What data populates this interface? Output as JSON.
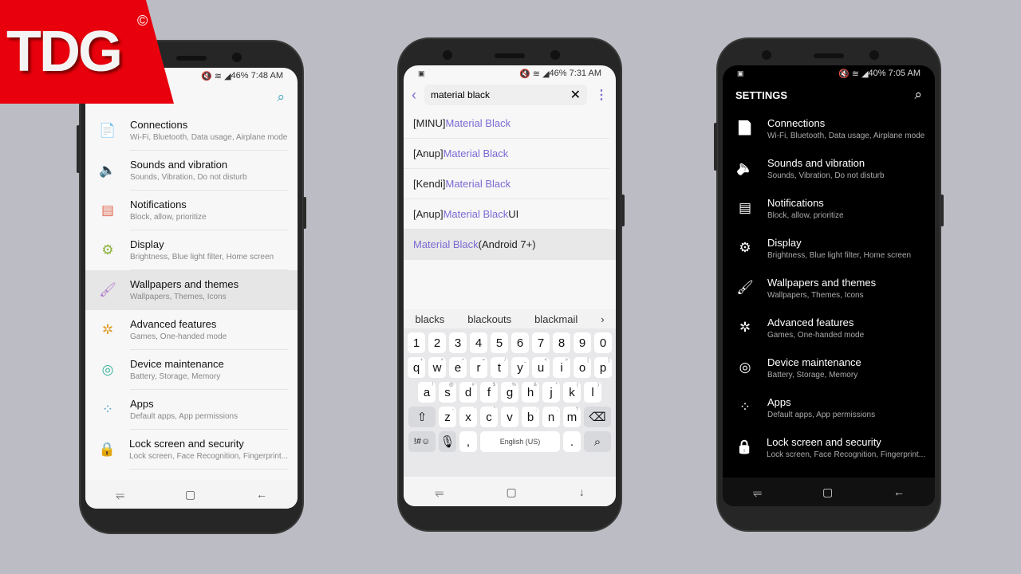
{
  "logo": {
    "text": "TDG",
    "mark": "©"
  },
  "colors": {
    "accent": "#7b6ad3",
    "logo_red": "#e8000c"
  },
  "left_phone": {
    "status": {
      "battery": "46%",
      "time": "7:48 AM"
    },
    "search_icon": "search-icon",
    "items": [
      {
        "title": "Connections",
        "sub": "Wi-Fi, Bluetooth, Data usage, Airplane mode",
        "icon": "📄",
        "color": "#4a9fc9"
      },
      {
        "title": "Sounds and vibration",
        "sub": "Sounds, Vibration, Do not disturb",
        "icon": "🔈",
        "color": "#4a7fc9"
      },
      {
        "title": "Notifications",
        "sub": "Block, allow, prioritize",
        "icon": "▤",
        "color": "#e06a50"
      },
      {
        "title": "Display",
        "sub": "Brightness, Blue light filter, Home screen",
        "icon": "⚙",
        "color": "#8ab13a"
      },
      {
        "title": "Wallpapers and themes",
        "sub": "Wallpapers, Themes, Icons",
        "icon": "🖌",
        "color": "#b07ac9",
        "selected": true
      },
      {
        "title": "Advanced features",
        "sub": "Games, One-handed mode",
        "icon": "✲",
        "color": "#e0a030"
      },
      {
        "title": "Device maintenance",
        "sub": "Battery, Storage, Memory",
        "icon": "◎",
        "color": "#3ab19a"
      },
      {
        "title": "Apps",
        "sub": "Default apps, App permissions",
        "icon": "⁘",
        "color": "#4a9fc9"
      },
      {
        "title": "Lock screen and security",
        "sub": "Lock screen, Face Recognition, Fingerprint...",
        "icon": "🔒",
        "color": "#7a6ac9"
      }
    ]
  },
  "middle_phone": {
    "status": {
      "battery": "46%",
      "time": "7:31 AM"
    },
    "query": "material black",
    "results": [
      {
        "pre": "[MINU]",
        "hl": "Material Black",
        "post": ""
      },
      {
        "pre": "[Anup] ",
        "hl": "Material Black",
        "post": ""
      },
      {
        "pre": "[Kendi] ",
        "hl": "Material Black",
        "post": ""
      },
      {
        "pre": "[Anup] ",
        "hl": "Material Black",
        "post": " UI"
      },
      {
        "pre": "",
        "hl": "Material Black",
        "post": " (Android 7+)",
        "selected": true
      }
    ],
    "suggestions": [
      "blacks",
      "blackouts",
      "blackmail"
    ],
    "keyboard": {
      "numbers": [
        "1",
        "2",
        "3",
        "4",
        "5",
        "6",
        "7",
        "8",
        "9",
        "0"
      ],
      "row1": [
        [
          "q",
          "+"
        ],
        [
          "w",
          "×"
        ],
        [
          "e",
          "÷"
        ],
        [
          "r",
          "="
        ],
        [
          "t",
          "/"
        ],
        [
          "y",
          "_"
        ],
        [
          "u",
          "<"
        ],
        [
          "i",
          ">"
        ],
        [
          "o",
          "["
        ],
        [
          "p",
          "]"
        ]
      ],
      "row2": [
        [
          "a",
          "!"
        ],
        [
          "s",
          "@"
        ],
        [
          "d",
          "#"
        ],
        [
          "f",
          "$"
        ],
        [
          "g",
          "%"
        ],
        [
          "h",
          "&"
        ],
        [
          "j",
          "*"
        ],
        [
          "k",
          "("
        ],
        [
          "l",
          ")"
        ]
      ],
      "row3": [
        [
          "z",
          "-"
        ],
        [
          "x",
          "'"
        ],
        [
          "c",
          "\""
        ],
        [
          "v",
          ":"
        ],
        [
          "b",
          ";"
        ],
        [
          "n",
          ","
        ],
        [
          "m",
          "?"
        ]
      ],
      "symbols": "!#☺",
      "space": "English (US)",
      "comma": ",",
      "period": "."
    }
  },
  "right_phone": {
    "status": {
      "battery": "40%",
      "time": "7:05 AM"
    },
    "title": "SETTINGS",
    "items": [
      {
        "title": "Connections",
        "sub": "Wi-Fi, Bluetooth, Data usage, Airplane mode",
        "icon": "📄"
      },
      {
        "title": "Sounds and vibration",
        "sub": "Sounds, Vibration, Do not disturb",
        "icon": "🔈"
      },
      {
        "title": "Notifications",
        "sub": "Block, allow, prioritize",
        "icon": "▤"
      },
      {
        "title": "Display",
        "sub": "Brightness, Blue light filter, Home screen",
        "icon": "⚙"
      },
      {
        "title": "Wallpapers and themes",
        "sub": "Wallpapers, Themes, Icons",
        "icon": "🖌"
      },
      {
        "title": "Advanced features",
        "sub": "Games, One-handed mode",
        "icon": "✲"
      },
      {
        "title": "Device maintenance",
        "sub": "Battery, Storage, Memory",
        "icon": "◎"
      },
      {
        "title": "Apps",
        "sub": "Default apps, App permissions",
        "icon": "⁘"
      },
      {
        "title": "Lock screen and security",
        "sub": "Lock screen, Face Recognition, Fingerprint...",
        "icon": "🔒"
      }
    ]
  }
}
